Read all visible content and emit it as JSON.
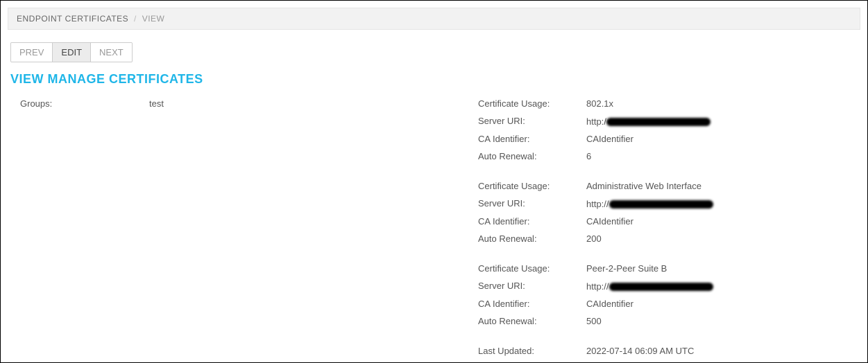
{
  "breadcrumb": {
    "main": "ENDPOINT CERTIFICATES",
    "sub": "VIEW"
  },
  "toolbar": {
    "prev": "PREV",
    "edit": "EDIT",
    "next": "NEXT"
  },
  "page_title": "VIEW MANAGE CERTIFICATES",
  "left": {
    "groups_label": "Groups:",
    "groups_value": "test"
  },
  "labels": {
    "cert_usage": "Certificate Usage:",
    "server_uri": "Server URI:",
    "ca_identifier": "CA Identifier:",
    "auto_renewal": "Auto Renewal:",
    "last_updated": "Last Updated:"
  },
  "certs": [
    {
      "usage": "802.1x",
      "uri_prefix": "http:/",
      "ca_identifier": "CAIdentifier",
      "auto_renewal": "6"
    },
    {
      "usage": "Administrative Web Interface",
      "uri_prefix": "http://",
      "ca_identifier": "CAIdentifier",
      "auto_renewal": "200"
    },
    {
      "usage": "Peer-2-Peer Suite B",
      "uri_prefix": "http://",
      "ca_identifier": "CAIdentifier",
      "auto_renewal": "500"
    }
  ],
  "last_updated": "2022-07-14 06:09 AM UTC"
}
